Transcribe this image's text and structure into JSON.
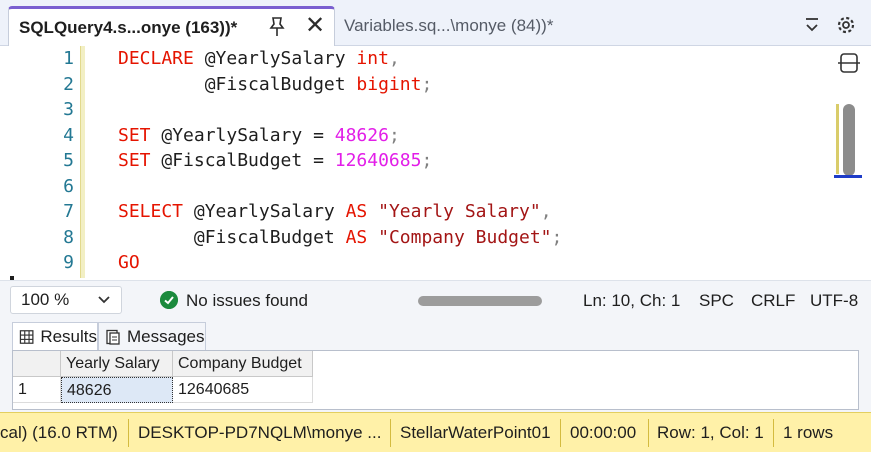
{
  "tabs": [
    {
      "label": "SQLQuery4.s...onye (163))*",
      "active": true
    },
    {
      "label": "Variables.sq...\\monye (84))*",
      "active": false
    }
  ],
  "editor": {
    "line_numbers": [
      "1",
      "2",
      "3",
      "4",
      "5",
      "6",
      "7",
      "8",
      "9"
    ],
    "lines": [
      {
        "kw1": "DECLARE",
        "t1": " @YearlySalary ",
        "kw2": "int",
        "p1": ","
      },
      {
        "t1": "        @FiscalBudget ",
        "kw2": "bigint",
        "p1": ";"
      },
      {},
      {
        "kw1": "SET",
        "t1": " @YearlySalary = ",
        "num": "48626",
        "p1": ";"
      },
      {
        "kw1": "SET",
        "t1": " @FiscalBudget = ",
        "num": "12640685",
        "p1": ";"
      },
      {},
      {
        "kw1": "SELECT",
        "t1": " @YearlySalary ",
        "kw2": "AS",
        "t2": " ",
        "str": "\"Yearly Salary\"",
        "p1": ","
      },
      {
        "t1": "       @FiscalBudget ",
        "kw2": "AS",
        "t2": " ",
        "str": "\"Company Budget\"",
        "p1": ";"
      },
      {
        "kw1": "GO"
      }
    ],
    "colors": {
      "keyword": "#e51400",
      "number": "#e21ee8",
      "string": "#a31515",
      "line_number": "#237893"
    }
  },
  "editor_status": {
    "zoom": "100 %",
    "issues": "No issues found",
    "position": "Ln: 10, Ch: 1",
    "spc": "SPC",
    "eol": "CRLF",
    "encoding": "UTF-8"
  },
  "results": {
    "tab_results": "Results",
    "tab_messages": "Messages",
    "columns": [
      "Yearly Salary",
      "Company Budget"
    ],
    "rows": [
      {
        "row_no": "1",
        "cells": [
          "48626",
          "12640685"
        ]
      }
    ]
  },
  "statusbar": {
    "server_version": "cal) (16.0 RTM)",
    "user": "DESKTOP-PD7NQLM\\monye ...",
    "database": "StellarWaterPoint01",
    "elapsed": "00:00:00",
    "rowcol": "Row: 1, Col: 1",
    "rows": "1 rows",
    "bg_color": "#fff1a8"
  }
}
